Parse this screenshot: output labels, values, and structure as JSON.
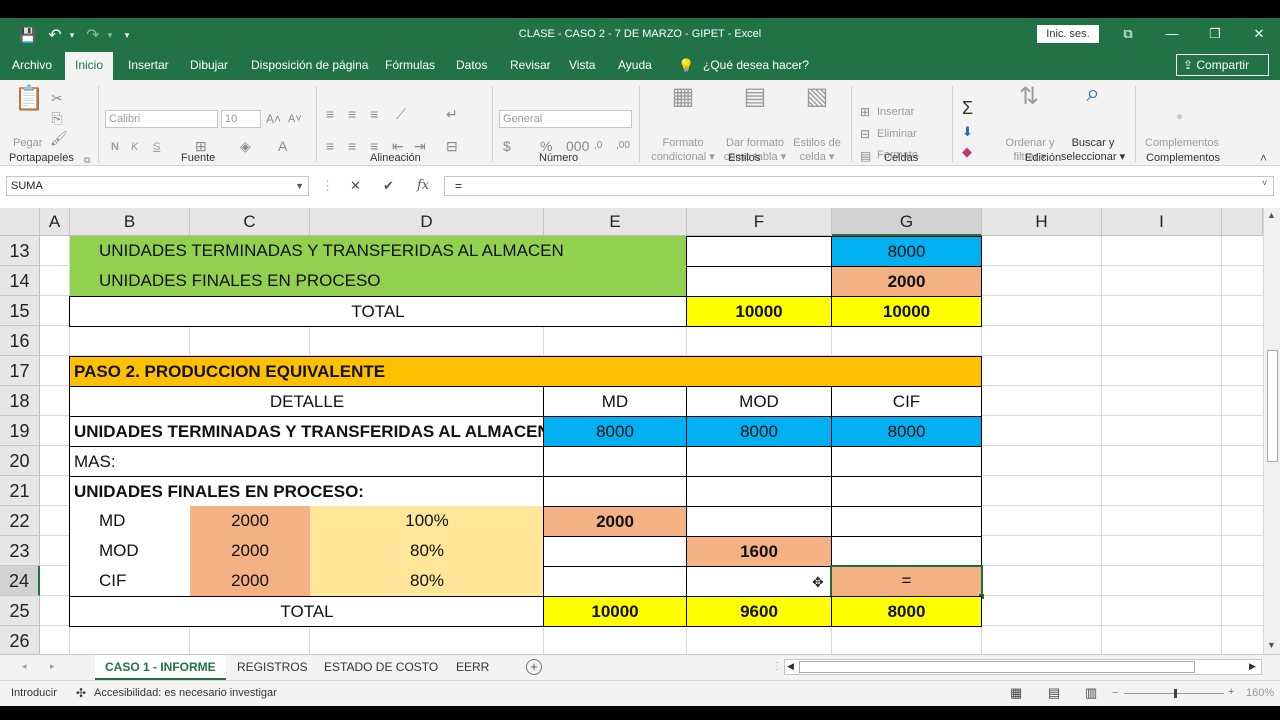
{
  "titlebar": {
    "title": "CLASE - CASO 2 - 7 DE MARZO - GIPET  -  Excel",
    "signin": "Inic. ses.",
    "save_glyph": "💾",
    "undo_glyph": "↶",
    "redo_glyph": "↷",
    "customize_glyph": "▾",
    "ribbon_display_glyph": "⧉",
    "min_glyph": "—",
    "max_glyph": "❐",
    "close_glyph": "✕"
  },
  "menu": {
    "tabs": [
      "Archivo",
      "Inicio",
      "Insertar",
      "Dibujar",
      "Disposición de página",
      "Fórmulas",
      "Datos",
      "Revisar",
      "Vista",
      "Ayuda"
    ],
    "tell_me": "¿Qué desea hacer?",
    "share": "Compartir"
  },
  "ribbon": {
    "clipboard": {
      "label": "Portapapeles",
      "paste": "Pegar"
    },
    "font": {
      "label": "Fuente",
      "name": "Calibri",
      "size": "10",
      "bold": "N",
      "italic": "K",
      "underline": "S"
    },
    "alignment": {
      "label": "Alineación"
    },
    "number": {
      "label": "Número",
      "format": "General"
    },
    "styles": {
      "label": "Estilos",
      "conditional": [
        "Formato",
        "condicional ▾"
      ],
      "as_table": [
        "Dar formato",
        "como tabla ▾"
      ],
      "cell_styles": [
        "Estilos de",
        "celda ▾"
      ]
    },
    "cells": {
      "label": "Celdas",
      "insert": "Insertar",
      "delete": "Eliminar",
      "format": "Formato"
    },
    "editing": {
      "label": "Edición",
      "sort": [
        "Ordenar y",
        "filtrar ▾"
      ],
      "find": [
        "Buscar y",
        "seleccionar ▾"
      ]
    },
    "addins": {
      "label": "Complementos",
      "button": "Complementos"
    }
  },
  "formula_bar": {
    "name_box": "SUMA",
    "cancel": "✕",
    "enter": "✔",
    "fx": "fx",
    "content": "="
  },
  "columns": [
    "A",
    "B",
    "C",
    "D",
    "E",
    "F",
    "G",
    "H",
    "I"
  ],
  "rows": [
    "13",
    "14",
    "15",
    "16",
    "17",
    "18",
    "19",
    "20",
    "21",
    "22",
    "23",
    "24",
    "25",
    "26"
  ],
  "cells": {
    "r13_label": "UNIDADES TERMINADAS Y TRANSFERIDAS AL ALMACEN",
    "r13_g": "8000",
    "r14_label": "UNIDADES FINALES EN PROCESO",
    "r14_g": "2000",
    "r15_total": "TOTAL",
    "r15_f": "10000",
    "r15_g": "10000",
    "r17_title": "PASO 2. PRODUCCION EQUIVALENTE",
    "r18_detalle": "DETALLE",
    "r18_md": "MD",
    "r18_mod": "MOD",
    "r18_cif": "CIF",
    "r19_label": "UNIDADES TERMINADAS Y TRANSFERIDAS AL ALMACEN",
    "r19_e": "8000",
    "r19_f": "8000",
    "r19_g": "8000",
    "r20_label": "MAS:",
    "r21_label": "UNIDADES FINALES EN PROCESO:",
    "r22_b": "MD",
    "r22_c": "2000",
    "r22_d": "100%",
    "r22_e": "2000",
    "r23_b": "MOD",
    "r23_c": "2000",
    "r23_d": "80%",
    "r23_f": "1600",
    "r24_b": "CIF",
    "r24_c": "2000",
    "r24_d": "80%",
    "r24_g": "=",
    "r25_total": "TOTAL",
    "r25_e": "10000",
    "r25_f": "9600",
    "r25_g": "8000"
  },
  "sheets": [
    "CASO 1 - INFORME",
    "REGISTROS",
    "ESTADO DE COSTO",
    "EERR"
  ],
  "status": {
    "mode": "Introducir",
    "accessibility": "Accesibilidad: es necesario investigar",
    "zoom": "160%"
  },
  "colors": {
    "excel_green": "#217346",
    "green_fill": "#92d050",
    "blue_fill": "#00b0f0",
    "salmon_fill": "#f4b183",
    "yellow_fill": "#ffff00",
    "orange_fill": "#ffc000",
    "light_yellow_fill": "#ffe699"
  }
}
